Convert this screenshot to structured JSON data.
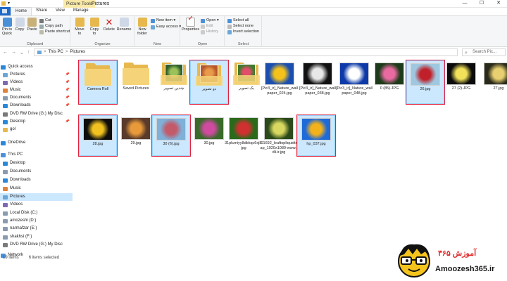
{
  "window": {
    "title": "Pictures",
    "context_group": "Picture Tools",
    "controls": [
      "—",
      "☐",
      "✕"
    ]
  },
  "tabs": [
    "Home",
    "Share",
    "View",
    "Manage"
  ],
  "ribbon": {
    "clipboard": {
      "label": "Clipboard",
      "pin": "Pin to Quick access",
      "copy": "Copy",
      "paste": "Paste",
      "cut": "Cut",
      "copy_path": "Copy path",
      "paste_shortcut": "Paste shortcut"
    },
    "organize": {
      "label": "Organize",
      "move_to": "Move to",
      "copy_to": "Copy to",
      "delete": "Delete",
      "rename": "Rename"
    },
    "new": {
      "label": "New",
      "new_folder": "New folder",
      "new_item": "New item ▾",
      "easy_access": "Easy access ▾"
    },
    "open": {
      "label": "Open",
      "properties": "Properties",
      "open": "Open ▾",
      "edit": "Edit",
      "history": "History"
    },
    "select": {
      "label": "Select",
      "select_all": "Select all",
      "select_none": "Select none",
      "invert": "Invert selection"
    }
  },
  "address": {
    "back": "←",
    "forward": "→",
    "up_list": "⌄",
    "up": "↑",
    "crumbs": [
      "This PC",
      ">",
      "Pictures"
    ],
    "search_placeholder": "Search Pic..."
  },
  "nav": {
    "items": [
      {
        "label": "Quick access",
        "color": "#2b88d8",
        "pin": ""
      },
      {
        "label": "Pictures",
        "color": "#6aa7d8",
        "pin": "📌"
      },
      {
        "label": "Videos",
        "color": "#7f6ab0",
        "pin": "📌"
      },
      {
        "label": "Music",
        "color": "#e0833a",
        "pin": "📌"
      },
      {
        "label": "Documents",
        "color": "#8a9bb0",
        "pin": "📌"
      },
      {
        "label": "Downloads",
        "color": "#2b88d8",
        "pin": "📌"
      },
      {
        "label": "DVD RW Drive (G:) My Disc",
        "color": "#7a7a7a",
        "pin": ""
      },
      {
        "label": "Desktop",
        "color": "#2b88d8",
        "pin": "📌"
      },
      {
        "label": "gol",
        "color": "#e7b84e",
        "pin": ""
      },
      {
        "label": "OneDrive",
        "color": "#2b88d8",
        "pin": ""
      },
      {
        "label": "This PC",
        "color": "#4a90d9",
        "pin": ""
      },
      {
        "label": "Desktop",
        "color": "#2b88d8",
        "pin": ""
      },
      {
        "label": "Documents",
        "color": "#8a9bb0",
        "pin": ""
      },
      {
        "label": "Downloads",
        "color": "#2b88d8",
        "pin": ""
      },
      {
        "label": "Music",
        "color": "#e0833a",
        "pin": ""
      },
      {
        "label": "Pictures",
        "color": "#6aa7d8",
        "pin": ""
      },
      {
        "label": "Videos",
        "color": "#7f6ab0",
        "pin": ""
      },
      {
        "label": "Local Disk (C:)",
        "color": "#8a9bb0",
        "pin": ""
      },
      {
        "label": "amozeshi (D:)",
        "color": "#8a9bb0",
        "pin": ""
      },
      {
        "label": "narmafzar (E:)",
        "color": "#8a9bb0",
        "pin": ""
      },
      {
        "label": "shakhsi (F:)",
        "color": "#8a9bb0",
        "pin": ""
      },
      {
        "label": "DVD RW Drive (G:) My Disc",
        "color": "#7a7a7a",
        "pin": ""
      },
      {
        "label": "Network",
        "color": "#4a90d9",
        "pin": ""
      }
    ]
  },
  "files": [
    {
      "label": "Camera Roll",
      "kind": "folder",
      "selected": true,
      "marked": true,
      "colors": [
        "#e7b84e",
        "#e7b84e"
      ]
    },
    {
      "label": "Saved Pictures",
      "kind": "folder",
      "selected": false,
      "marked": false,
      "colors": [
        "#e7b84e",
        "#e7b84e"
      ]
    },
    {
      "label": "چندین تصویر",
      "kind": "folderpic",
      "selected": false,
      "marked": false,
      "colors": [
        "#2e5e2a",
        "#9bc25a"
      ]
    },
    {
      "label": "دو تصویر",
      "kind": "folderpic",
      "selected": true,
      "marked": true,
      "colors": [
        "#b5562a",
        "#e89a4a"
      ]
    },
    {
      "label": "یک تصویر",
      "kind": "folderpic",
      "selected": false,
      "marked": false,
      "colors": [
        "#3e7a2e",
        "#e24d6a"
      ]
    },
    {
      "label": "[Pic3_ir]_Nature_wallpaper_024.jpg",
      "kind": "photo",
      "selected": false,
      "marked": false,
      "colors": [
        "#1a4fb0",
        "#f4c21a"
      ]
    },
    {
      "label": "[Pic3_ir]_Nature_wallpaper_038.jpg",
      "kind": "photo",
      "selected": false,
      "marked": false,
      "colors": [
        "#111111",
        "#e8e8e8"
      ]
    },
    {
      "label": "[Pic3_ir]_Nature_wallpaper_048.jpg",
      "kind": "photo",
      "selected": false,
      "marked": false,
      "colors": [
        "#0d3aa8",
        "#ffffff"
      ]
    },
    {
      "label": "0 (85).JPG",
      "kind": "photo",
      "selected": false,
      "marked": false,
      "colors": [
        "#1d3b1a",
        "#e86aa0"
      ]
    },
    {
      "label": "26.jpg",
      "kind": "photo",
      "selected": true,
      "marked": true,
      "colors": [
        "#9fc8e0",
        "#c0202a"
      ]
    },
    {
      "label": "27 (2).JPG",
      "kind": "photo",
      "selected": false,
      "marked": false,
      "colors": [
        "#0b0b0b",
        "#f2e25a"
      ]
    },
    {
      "label": "27.jpg",
      "kind": "photo",
      "selected": false,
      "marked": false,
      "colors": [
        "#2a2a1a",
        "#e8d070"
      ]
    },
    {
      "label": "28.jpg",
      "kind": "photo",
      "selected": true,
      "marked": true,
      "colors": [
        "#0d0d0d",
        "#f1c21f"
      ]
    },
    {
      "label": "29.jpg",
      "kind": "photo",
      "selected": false,
      "marked": false,
      "colors": [
        "#5a3a2a",
        "#e89a3a"
      ]
    },
    {
      "label": "30 (6).jpg",
      "kind": "photo",
      "selected": true,
      "marked": true,
      "colors": [
        "#7fb0d8",
        "#c25a6a"
      ]
    },
    {
      "label": "30.jpg",
      "kind": "photo",
      "selected": false,
      "marked": false,
      "colors": [
        "#3a6a2a",
        "#d04aa0"
      ]
    },
    {
      "label": "31pkzniyy8dbkqc6xj8.jpg",
      "kind": "photo",
      "selected": false,
      "marked": false,
      "colors": [
        "#2a6a1a",
        "#d03030"
      ]
    },
    {
      "label": "01692_leaftopliquidtrap_1920x1080-www.fdli.ir.jpg",
      "kind": "photo",
      "selected": false,
      "marked": false,
      "colors": [
        "#2a4a1a",
        "#d8d860"
      ]
    },
    {
      "label": "hp_037.jpg",
      "kind": "photo",
      "selected": true,
      "marked": true,
      "colors": [
        "#1e6ad8",
        "#f4b21a"
      ]
    }
  ],
  "status": {
    "count": "19 items",
    "selected": "6 items selected"
  },
  "watermark": {
    "brand": "آموزش ۳۶۵",
    "site": "Amoozesh365.ir"
  }
}
